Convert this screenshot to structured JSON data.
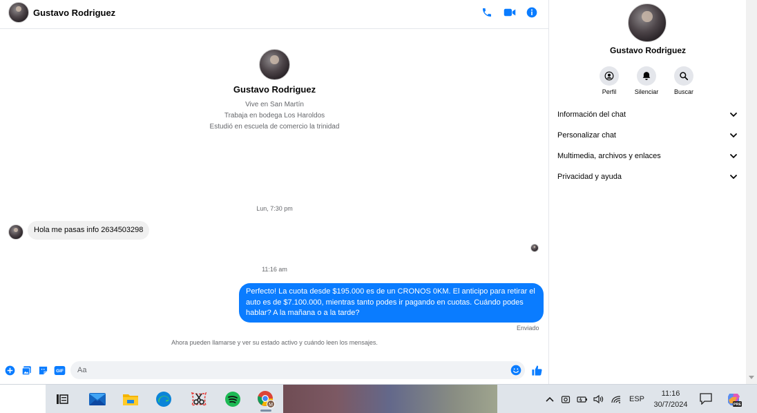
{
  "header": {
    "contact_name": "Gustavo Rodriguez",
    "icons": [
      "phone-icon",
      "video-icon",
      "info-icon"
    ]
  },
  "intro": {
    "name": "Gustavo Rodriguez",
    "lines": [
      "Vive en San Martín",
      "Trabaja en bodega Los Haroldos",
      "Estudió en escuela de comercio la trinidad"
    ]
  },
  "conversation": {
    "separator_1": "Lun, 7:30 pm",
    "incoming_message": "Hola me pasas info 2634503298",
    "separator_2": "11:16 am",
    "outgoing_message": "Perfecto! La cuota desde $195.000 es de un CRONOS 0KM. El anticipo para retirar el auto es de $7.100.000, mientras tanto podes ir pagando en cuotas. Cuándo podes hablar? A la mañana o a la tarde?",
    "sent_status": "Enviado",
    "notice": "Ahora pueden llamarse y ver su estado activo y cuándo leen los mensajes."
  },
  "composer": {
    "placeholder": "Aa",
    "value": "",
    "gif_label": "GIF",
    "icons": [
      "plus-icon",
      "gallery-icon",
      "sticker-icon",
      "gif-icon",
      "emoji-icon",
      "like-icon"
    ]
  },
  "info_panel": {
    "name": "Gustavo Rodriguez",
    "actions": [
      {
        "label": "Perfil",
        "icon": "profile-icon"
      },
      {
        "label": "Silenciar",
        "icon": "bell-icon"
      },
      {
        "label": "Buscar",
        "icon": "search-icon"
      }
    ],
    "menu": [
      {
        "label": "Información del chat"
      },
      {
        "label": "Personalizar chat"
      },
      {
        "label": "Multimedia, archivos y enlaces"
      },
      {
        "label": "Privacidad y ayuda"
      }
    ]
  },
  "taskbar": {
    "apps": [
      "task-view-icon",
      "mail-icon",
      "file-explorer-icon",
      "edge-icon",
      "snipping-tool-icon",
      "spotify-icon",
      "chrome-icon"
    ],
    "language": "ESP",
    "time": "11:16",
    "date": "30/7/2024",
    "copilot_badge": "PRE"
  },
  "colors": {
    "accent": "#0a7cff",
    "incoming_bubble": "#f0f0f0",
    "secondary_text": "#65676b"
  }
}
